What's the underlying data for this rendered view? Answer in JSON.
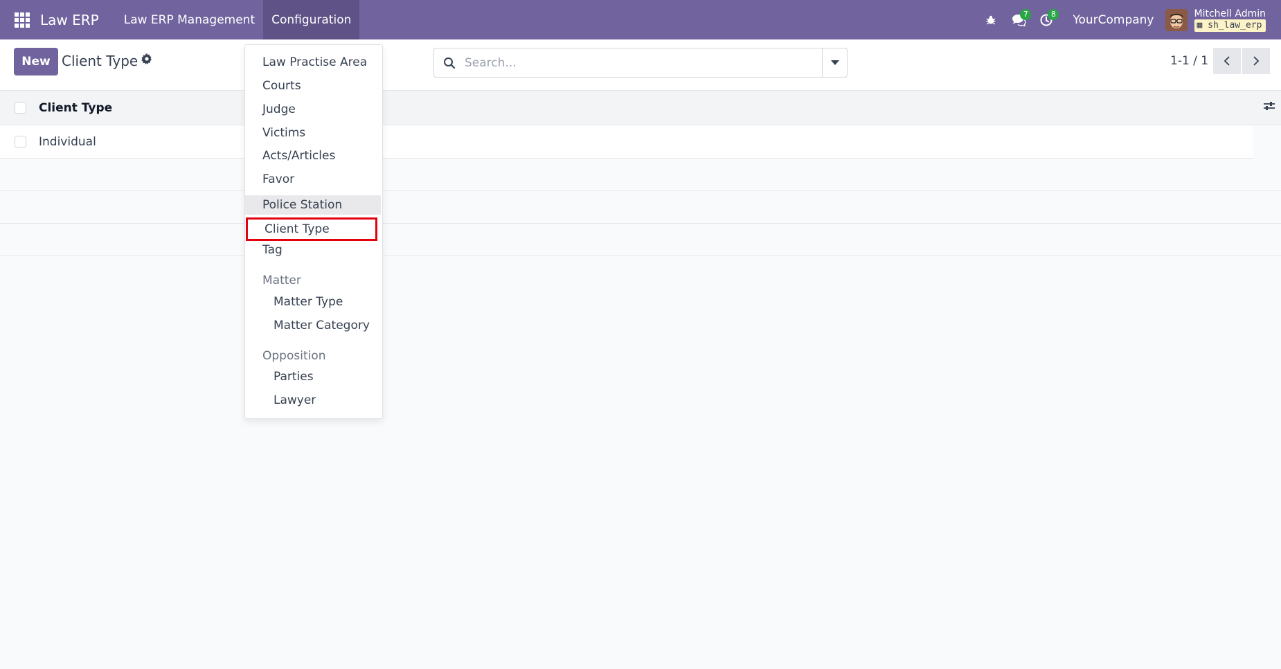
{
  "navbar": {
    "brand": "Law ERP",
    "menu": [
      "Law ERP Management",
      "Configuration"
    ],
    "messages_count": "7",
    "activities_count": "8",
    "company": "YourCompany",
    "user_name": "Mitchell Admin",
    "db_name": "sh_law_erp",
    "accent": "#71639e"
  },
  "control": {
    "new_label": "New",
    "title": "Client Type",
    "search_placeholder": "Search...",
    "pager": "1-1 / 1"
  },
  "list": {
    "column_header": "Client Type",
    "rows": [
      "Individual"
    ]
  },
  "config_menu": {
    "items": [
      "Law Practise Area",
      "Courts",
      "Judge",
      "Victims",
      "Acts/Articles",
      "Favor",
      "Police Station",
      "Client Type",
      "Tag"
    ],
    "highlighted": "Police Station",
    "selected": "Client Type",
    "sections": [
      {
        "header": "Matter",
        "items": [
          "Matter Type",
          "Matter Category"
        ]
      },
      {
        "header": "Opposition",
        "items": [
          "Parties",
          "Lawyer"
        ]
      }
    ]
  }
}
